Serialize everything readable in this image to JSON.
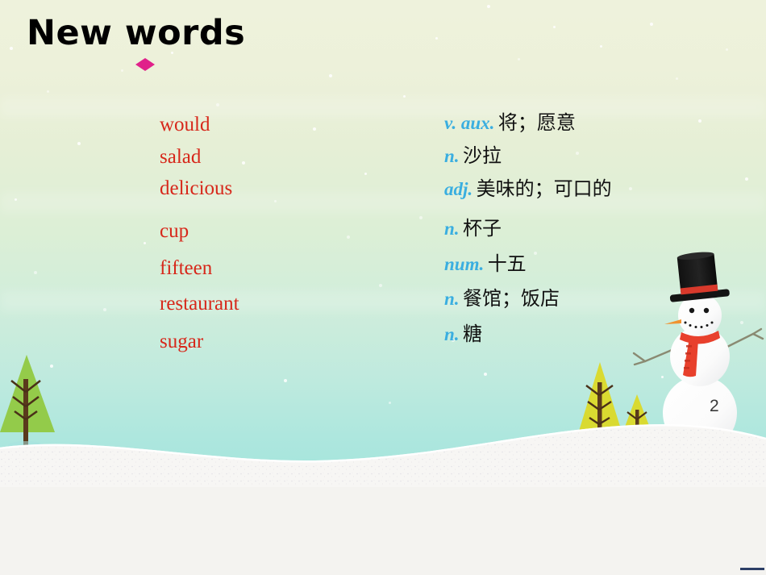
{
  "slide": {
    "title": "New words",
    "page_number": "2",
    "accent_colors": {
      "bullet": "#e0218a",
      "word": "#d7271a",
      "pos": "#3aaee0",
      "meaning": "#111111",
      "sky_top": "#eef2dc",
      "sky_bottom": "#a3e4dc",
      "snow": "#f6f5f3"
    }
  },
  "vocabulary": [
    {
      "word": "would",
      "pos": "v. aux.",
      "meaning": "将；愿意"
    },
    {
      "word": "salad",
      "pos": "n.",
      "meaning": "沙拉"
    },
    {
      "word": "delicious",
      "pos": "adj.",
      "meaning": "美味的；可口的"
    },
    {
      "word": "cup",
      "pos": "n.",
      "meaning": "杯子"
    },
    {
      "word": "fifteen",
      "pos": "num.",
      "meaning": "十五"
    },
    {
      "word": "restaurant",
      "pos": "n.",
      "meaning": "餐馆；饭店"
    },
    {
      "word": "sugar",
      "pos": "n.",
      "meaning": "糖"
    }
  ],
  "illustration": {
    "snowman": {
      "hat_color": "#1a1a1a",
      "hat_band_color": "#d8392b",
      "nose_color": "#f0922f",
      "scarf_color": "#e8402c",
      "body_color": "#fdfdfd"
    },
    "trees": [
      {
        "name": "large-left-tree",
        "foliage_color": "#8cc63f"
      },
      {
        "name": "medium-right-tree",
        "foliage_color": "#dbd927"
      },
      {
        "name": "small-right-tree",
        "foliage_color": "#dbd927"
      }
    ]
  }
}
